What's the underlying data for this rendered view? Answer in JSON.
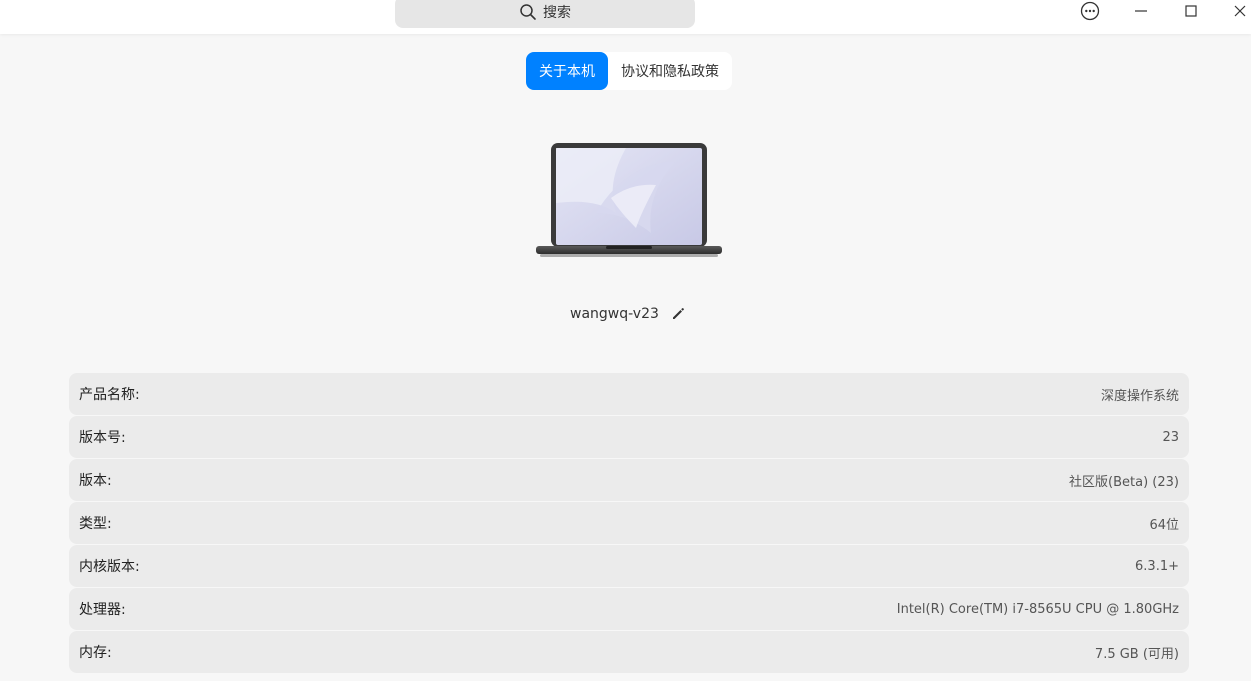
{
  "titlebar": {
    "search_label": "搜索",
    "icons": [
      "search-icon",
      "more-icon",
      "minimize-icon",
      "maximize-icon",
      "close-icon"
    ]
  },
  "tabs": [
    {
      "label": "关于本机",
      "active": true
    },
    {
      "label": "协议和隐私政策",
      "active": false
    }
  ],
  "device": {
    "hostname": "wangwq-v23"
  },
  "info_rows": [
    {
      "key": "产品名称:",
      "value": "深度操作系统"
    },
    {
      "key": "版本号:",
      "value": "23"
    },
    {
      "key": "版本:",
      "value": "社区版(Beta) (23)"
    },
    {
      "key": "类型:",
      "value": "64位"
    },
    {
      "key": "内核版本:",
      "value": "6.3.1+"
    },
    {
      "key": "处理器:",
      "value": "Intel(R) Core(TM) i7-8565U CPU @ 1.80GHz"
    },
    {
      "key": "内存:",
      "value": "7.5 GB (可用)"
    }
  ],
  "colors": {
    "accent": "#0081ff",
    "background": "#f7f7f7",
    "row": "#ebebeb"
  }
}
